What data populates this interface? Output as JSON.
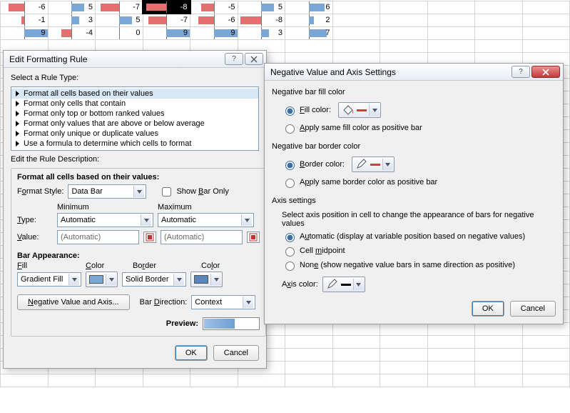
{
  "sheet": {
    "rows": [
      [
        -6,
        5,
        -7,
        -8,
        -5,
        5,
        6
      ],
      [
        -1,
        3,
        5,
        -7,
        -6,
        -8,
        2
      ],
      [
        9,
        -4,
        0,
        9,
        9,
        3,
        7
      ]
    ],
    "selected": [
      0,
      3
    ]
  },
  "dlg1": {
    "title": "Edit Formatting Rule",
    "select_rule_label": "Select a Rule Type:",
    "rule_types": [
      "Format all cells based on their values",
      "Format only cells that contain",
      "Format only top or bottom ranked values",
      "Format only values that are above or below average",
      "Format only unique or duplicate values",
      "Use a formula to determine which cells to format"
    ],
    "rule_types_selected": 0,
    "edit_desc_label": "Edit the Rule Description:",
    "format_heading": "Format all cells based on their values:",
    "format_style_label": "Format Style:",
    "format_style_value": "Data Bar",
    "show_bar_only_label": "Show Bar Only",
    "min_label": "Minimum",
    "max_label": "Maximum",
    "type_label": "Type:",
    "type_min": "Automatic",
    "type_max": "Automatic",
    "value_label": "Value:",
    "value_min": "(Automatic)",
    "value_max": "(Automatic)",
    "bar_appearance_label": "Bar Appearance:",
    "fill_label": "Fill",
    "fill_value": "Gradient Fill",
    "color_label": "Color",
    "border_label": "Border",
    "border_value": "Solid Border",
    "neg_axis_btn": "Negative Value and Axis...",
    "bar_direction_label": "Bar Direction:",
    "bar_direction_value": "Context",
    "preview_label": "Preview:",
    "ok": "OK",
    "cancel": "Cancel",
    "bar_fill_color": "#7ba7d7",
    "bar_border_color": "#5a85bd"
  },
  "dlg2": {
    "title": "Negative Value and Axis Settings",
    "neg_fill_heading": "Negative bar fill color",
    "fill_color_label": "Fill color:",
    "fill_color_value": "#d83a3a",
    "apply_same_fill_label": "Apply same fill color as positive bar",
    "neg_border_heading": "Negative bar border color",
    "border_color_label": "Border color:",
    "border_color_value": "#d83a3a",
    "apply_same_border_label": "Apply same border color as positive bar",
    "axis_heading": "Axis settings",
    "axis_instruction": "Select axis position in cell to change the appearance of bars for negative values",
    "axis_auto_label": "Automatic (display at variable position based on negative values)",
    "axis_mid_label": "Cell midpoint",
    "axis_none_label": "None (show negative value bars in same direction as positive)",
    "axis_color_label": "Axis color:",
    "axis_color_value": "#000000",
    "ok": "OK",
    "cancel": "Cancel"
  }
}
